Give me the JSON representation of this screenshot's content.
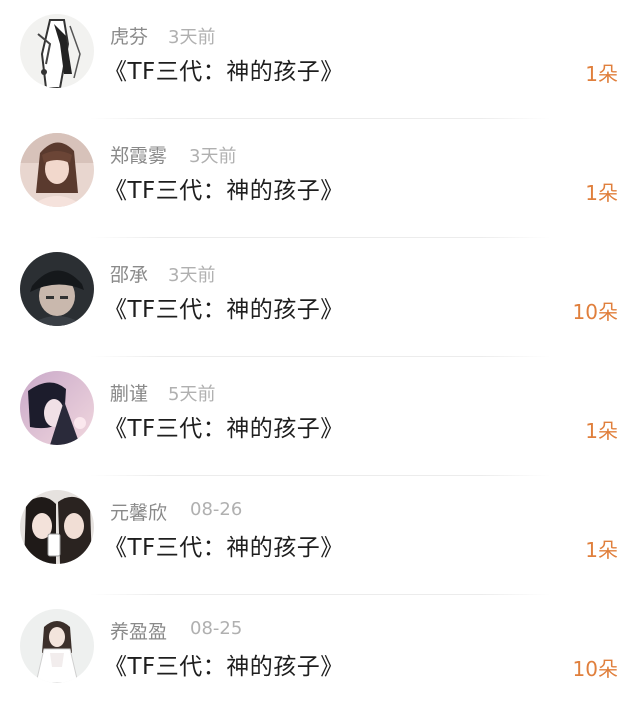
{
  "gifts": [
    {
      "name": "虎芬",
      "time": "3天前",
      "title": "《TF三代：神的孩子》",
      "count": "1朵",
      "avatar_icon": "avatar-sketch-figure"
    },
    {
      "name": "郑霞雾",
      "time": "3天前",
      "title": "《TF三代：神的孩子》",
      "count": "1朵",
      "avatar_icon": "avatar-girl-portrait"
    },
    {
      "name": "邵承",
      "time": "3天前",
      "title": "《TF三代：神的孩子》",
      "count": "10朵",
      "avatar_icon": "avatar-boy-cap"
    },
    {
      "name": "蒯谨",
      "time": "5天前",
      "title": "《TF三代：神的孩子》",
      "count": "1朵",
      "avatar_icon": "avatar-anime-boy"
    },
    {
      "name": "元馨欣",
      "time": "08-26",
      "title": "《TF三代：神的孩子》",
      "count": "1朵",
      "avatar_icon": "avatar-two-girls"
    },
    {
      "name": "养盈盈",
      "time": "08-25",
      "title": "《TF三代：神的孩子》",
      "count": "10朵",
      "avatar_icon": "avatar-girl-white-dress"
    }
  ],
  "colors": {
    "count": "#e07f3c",
    "name": "#8a8a8a",
    "time": "#b0b0b0",
    "title": "#1e1e1e"
  }
}
